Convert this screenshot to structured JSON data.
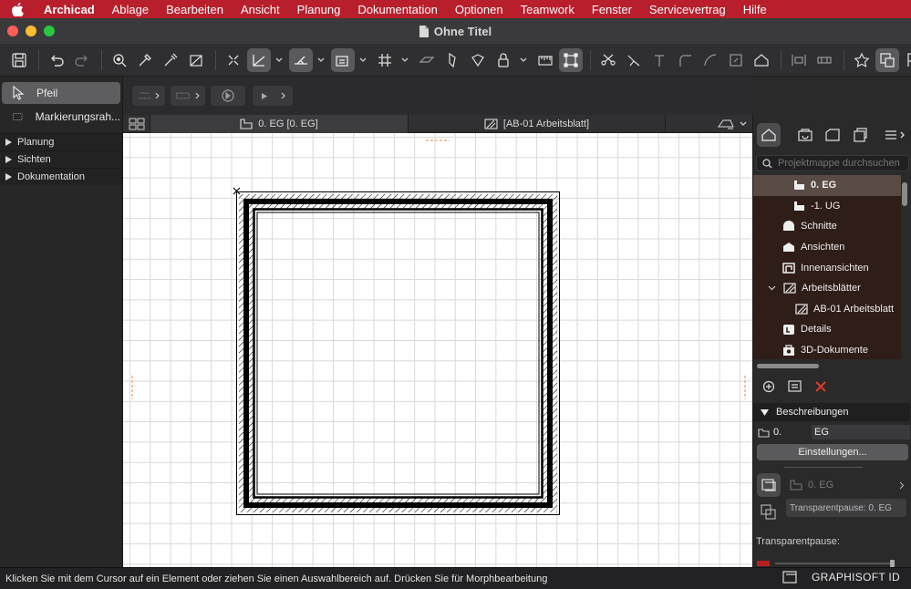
{
  "menubar": {
    "items": [
      "Archicad",
      "Ablage",
      "Bearbeiten",
      "Ansicht",
      "Planung",
      "Dokumentation",
      "Optionen",
      "Teamwork",
      "Fenster",
      "Servicevertrag",
      "Hilfe"
    ]
  },
  "window": {
    "title": "Ohne Titel"
  },
  "toolbox": {
    "tools": [
      {
        "label": "Pfeil",
        "icon": "arrow-pointer-icon",
        "selected": true
      },
      {
        "label": "Markierungsrah...",
        "icon": "marquee-icon",
        "selected": false
      }
    ],
    "groups": [
      "Planung",
      "Sichten",
      "Dokumentation"
    ]
  },
  "tabs": [
    {
      "label": "0. EG [0. EG]",
      "icon": "floor-plan-icon",
      "active": true
    },
    {
      "label": "[AB-01 Arbeitsblatt]",
      "icon": "worksheet-icon",
      "active": false
    }
  ],
  "navigator": {
    "search_placeholder": "Projektmappe durchsuchen",
    "tree": [
      {
        "label": "0. EG",
        "icon": "story-icon",
        "indent": 2,
        "selected": true
      },
      {
        "label": "-1. UG",
        "icon": "story-icon",
        "indent": 2,
        "selected": false
      },
      {
        "label": "Schnitte",
        "icon": "section-icon",
        "indent": 1,
        "selected": false
      },
      {
        "label": "Ansichten",
        "icon": "elevation-icon",
        "indent": 1,
        "selected": false
      },
      {
        "label": "Innenansichten",
        "icon": "interior-elevation-icon",
        "indent": 1,
        "selected": false
      },
      {
        "label": "Arbeitsblätter",
        "icon": "worksheet-icon",
        "indent": 1,
        "selected": false,
        "expanded": true
      },
      {
        "label": "AB-01 Arbeitsblatt",
        "icon": "worksheet-icon",
        "indent": 2,
        "selected": false
      },
      {
        "label": "Details",
        "icon": "detail-icon",
        "indent": 1,
        "selected": false
      },
      {
        "label": "3D-Dokumente",
        "icon": "3d-document-icon",
        "indent": 1,
        "selected": false
      }
    ],
    "description_header": "Beschreibungen",
    "description_number": "0.",
    "description_name": "EG",
    "settings_button": "Einstellungen...",
    "view_label": "0. EG",
    "transparent_tooltip": "Transparentpause: 0. EG",
    "transparent_label": "Transparentpause:"
  },
  "statusbar": {
    "message": "Klicken Sie mit dem Cursor auf ein Element oder ziehen Sie einen Auswahlbereich auf. Drücken Sie für Morphbearbeitung",
    "brand": "GRAPHISOFT ID"
  },
  "colors": {
    "menubar": "#b81e2c",
    "tree_bg": "#2f1d18",
    "delete": "#e0392b"
  }
}
